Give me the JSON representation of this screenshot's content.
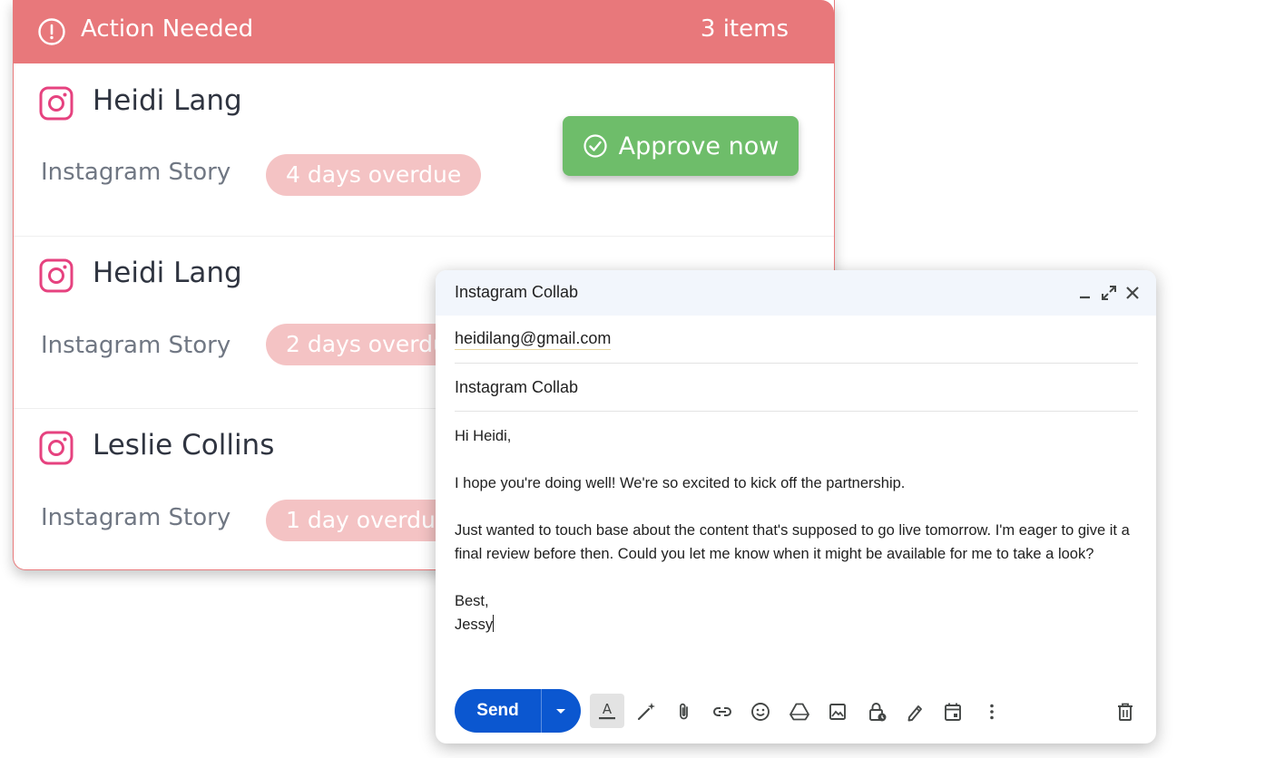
{
  "action_card": {
    "title": "Action Needed",
    "count": "3 items",
    "approve_label": "Approve now",
    "rows": [
      {
        "name": "Heidi Lang",
        "type": "Instagram Story",
        "overdue": "4 days overdue"
      },
      {
        "name": "Heidi Lang",
        "type": "Instagram Story",
        "overdue": "2 days overdue"
      },
      {
        "name": "Leslie Collins",
        "type": "Instagram Story",
        "overdue": "1 day overdue"
      }
    ],
    "icons": {
      "alert": "alert-circle-icon",
      "row": "instagram-icon",
      "approve": "check-circle-icon"
    }
  },
  "compose": {
    "title": "Instagram Collab",
    "to": "heidilang@gmail.com",
    "subject": "Instagram Collab",
    "body": {
      "greeting": "Hi Heidi,",
      "para1": "I hope you're doing well! We're so excited to kick off the partnership.",
      "para2": "Just wanted to touch base about the content that's supposed to go live tomorrow. I'm eager to give it a final review before then. Could you let me know when it might be available for me to take a look?",
      "signoff": "Best,",
      "signature": "Jessy"
    },
    "send_label": "Send",
    "header_icons": [
      "minimize-icon",
      "pop-out-icon",
      "close-icon"
    ],
    "toolbar_icons": [
      "formatting-icon",
      "magic-write-icon",
      "attach-icon",
      "link-icon",
      "emoji-icon",
      "drive-icon",
      "photo-icon",
      "confidential-icon",
      "signature-icon",
      "schedule-icon",
      "more-options-icon",
      "discard-icon"
    ]
  },
  "colors": {
    "action_header": "#e8787b",
    "overdue_badge": "#f4c3c4",
    "approve_green": "#6ebd6a",
    "instagram_pink": "#e6427f",
    "send_blue": "#0b57d0",
    "compose_header": "#f2f6fc"
  }
}
